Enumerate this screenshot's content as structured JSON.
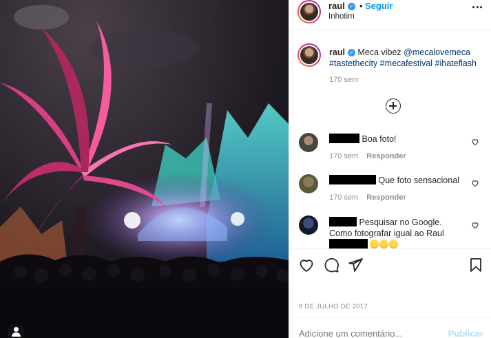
{
  "post": {
    "username": "raul",
    "follow_label": "Seguir",
    "separator": "•",
    "location": "Inhotim",
    "caption": {
      "username": "raul",
      "text": "Meca vibez",
      "mention": "@mecalovemeca",
      "hashtags": "#tastethecity #mecafestival #ihateflash",
      "time": "170 sem"
    },
    "date": "8 DE JULHO DE 2017"
  },
  "comments": [
    {
      "text": "Boa foto!",
      "time": "170 sem",
      "reply_label": "Responder"
    },
    {
      "text": "Que foto sensacional",
      "time": "170 sem",
      "reply_label": "Responder"
    },
    {
      "text_line1": "Pesquisar no Google.",
      "text_line2": "Como fotografar igual ao Raul"
    }
  ],
  "add_comment": {
    "placeholder": "Adicione um comentário...",
    "publish_label": "Publicar"
  },
  "colors": {
    "accent": "#0095f6",
    "hashtag": "#00376b",
    "muted": "#8e8e8e",
    "verified": "#3897f0",
    "publish_disabled": "#b2dffc"
  },
  "icons": {
    "more": "more-options-icon",
    "load_more": "plus-circle-icon",
    "like": "heart-icon",
    "comment": "comment-icon",
    "share": "paper-plane-icon",
    "save": "bookmark-icon",
    "user_tag": "user-tag-icon"
  }
}
